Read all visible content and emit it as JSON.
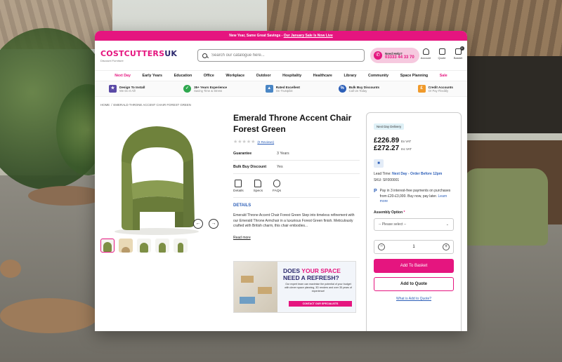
{
  "promo": {
    "text": "New Year, Same Great Savings - ",
    "link": "Our January Sale Is Now Live"
  },
  "header": {
    "logo_a": "COSTCUTTERS",
    "logo_b": "UK",
    "logo_tag": "Discount Furniture",
    "search_placeholder": "Search our catalogue here...",
    "help_label": "Need Help?",
    "help_phone": "03333 44 33 70",
    "account_label": "Account",
    "quote_label": "Quote",
    "basket_label": "Basket",
    "basket_count": "0"
  },
  "nav": [
    "Next Day",
    "Early Years",
    "Education",
    "Office",
    "Workplace",
    "Outdoor",
    "Hospitality",
    "Healthcare",
    "Library",
    "Community",
    "Space Planning",
    "Sale"
  ],
  "usp": [
    {
      "title": "Design To Install",
      "sub": "We Do It All!",
      "color": "#5b4aa6",
      "glyph": "★"
    },
    {
      "title": "35+ Years Experience",
      "sub": "Saving Time & Stress",
      "color": "#2fa84f",
      "glyph": "✓"
    },
    {
      "title": "Rated Excellent",
      "sub": "On Trustpilot",
      "color": "#4a86c5",
      "glyph": "▲"
    },
    {
      "title": "Bulk Buy Discounts",
      "sub": "Call Us Today",
      "color": "#2d5fb8",
      "glyph": "%"
    },
    {
      "title": "Credit Accounts",
      "sub": "Or Pay Flexibly",
      "color": "#f09a2b",
      "glyph": "£"
    }
  ],
  "breadcrumb": {
    "home": "HOME",
    "sep": "/",
    "current": "EMERALD THRONE ACCENT CHAIR FOREST GREEN"
  },
  "product": {
    "title": "Emerald Throne Accent Chair Forest Green",
    "stars": "★★★★★",
    "reviews": "(0 Reviews)",
    "specs": [
      {
        "k": "Guarantee",
        "v": "3 Years"
      },
      {
        "k": "Bulk Buy Discount",
        "v": "Yes"
      }
    ],
    "tabs": [
      "Details",
      "Specs",
      "FAQs"
    ],
    "details_heading": "DETAILS",
    "description": "Emerald Throne Accent Chair Forest Green Step into timeless refinement with our Emerald Throne Armchair in a luxurious Forest Green finish. Meticulously crafted with British charm, this chair embodies...",
    "read_more": "Read more",
    "color_main": "#7a8c44"
  },
  "banner": {
    "line1a": "DOES ",
    "line1b": "YOUR SPACE",
    "line2": "NEED A REFRESH?",
    "sub": "Our expert team can maximise the potential of your budget with clever space planning, 3D renders and over 35 years of experience!",
    "cta": "CONTACT OUR SPECIALISTS"
  },
  "buy": {
    "badge": "Next Day Delivery",
    "price_ex": "£226.89",
    "price_ex_label": "Ex VAT",
    "price_inc": "£272.27",
    "price_inc_label": "Inc VAT",
    "lead_label": "Lead Time: ",
    "lead_value": "Next Day - Order Before 12pm",
    "sku": "SKU: SF000001",
    "paypal_text": "Pay in 3 interest-free payments on purchases from £20-£3,000. Buy now, pay later.",
    "learn_more": "Learn more",
    "assembly_label": "Assembly Option",
    "assembly_required": "*",
    "assembly_select": "-- Please select --",
    "qty": "1",
    "add_basket": "Add To Basket",
    "add_quote": "Add to Quote",
    "what_is": "What is Add to Quote?"
  }
}
